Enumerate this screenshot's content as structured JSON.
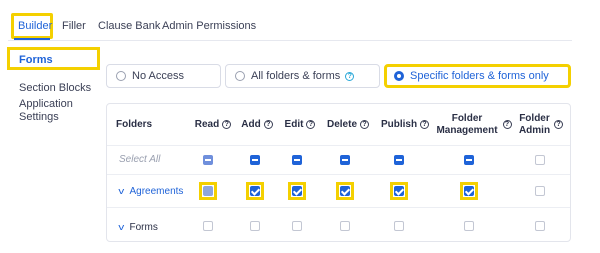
{
  "tabs": [
    {
      "label": "Builder",
      "active": true
    },
    {
      "label": "Filler",
      "active": false
    },
    {
      "label": "Clause Bank",
      "active": false
    },
    {
      "label": "Admin Permissions",
      "active": false
    }
  ],
  "sidebar": {
    "items": [
      {
        "label": "Forms",
        "active": true
      },
      {
        "label": "Section Blocks",
        "active": false
      },
      {
        "label": "Application Settings",
        "active": false
      }
    ]
  },
  "access": {
    "options": [
      {
        "label": "No Access",
        "selected": false,
        "help_icon": false
      },
      {
        "label": "All folders & forms",
        "selected": false,
        "help_icon": true
      },
      {
        "label": "Specific folders & forms only",
        "selected": true,
        "help_icon": false
      }
    ]
  },
  "table": {
    "headers": {
      "folders": "Folders",
      "read": "Read",
      "add": "Add",
      "edit": "Edit",
      "delete": "Delete",
      "publish": "Publish",
      "folder_management_1": "Folder",
      "folder_management_2": "Management",
      "folder_admin_1": "Folder",
      "folder_admin_2": "Admin"
    },
    "help_glyph": "?",
    "chevron_glyph": "v",
    "rows": [
      {
        "label": "Select All",
        "read": "partial",
        "add": "indeterminate",
        "edit": "indeterminate",
        "delete": "indeterminate",
        "publish": "indeterminate",
        "folder_management": "indeterminate",
        "folder_admin": "unchecked"
      },
      {
        "label": "Agreements",
        "expandable": true,
        "read": "checked-disabled",
        "add": "checked",
        "edit": "checked",
        "delete": "checked",
        "publish": "checked",
        "folder_management": "checked",
        "folder_admin": "unchecked"
      },
      {
        "label": "Forms",
        "expandable": true,
        "read": "unchecked",
        "add": "unchecked",
        "edit": "unchecked",
        "delete": "unchecked",
        "publish": "unchecked",
        "folder_management": "unchecked",
        "folder_admin": "unchecked"
      }
    ]
  },
  "colors": {
    "accent": "#1f63d8",
    "highlight": "#f4d000",
    "help_icon_blue": "#2aa8d8"
  }
}
